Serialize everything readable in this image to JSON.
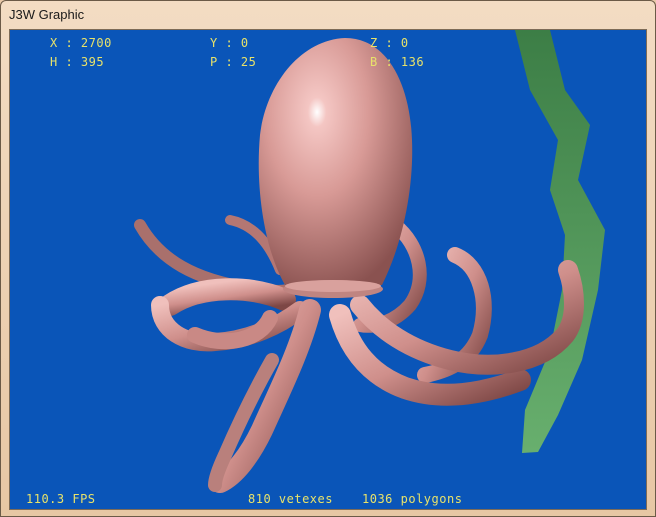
{
  "window": {
    "title": "J3W Graphic"
  },
  "hud": {
    "x": "X : 2700",
    "y": "Y : 0",
    "z": "Z : 0",
    "h": "H : 395",
    "p": "P : 25",
    "b": "B : 136",
    "fps": "110.3 FPS",
    "vertexes": "810 vetexes",
    "polygons": "1036 polygons"
  },
  "colors": {
    "background": "#0a55b8",
    "hud_text": "#e8e26a",
    "octopus": "#d99b97",
    "seaweed": "#4f9a55"
  }
}
